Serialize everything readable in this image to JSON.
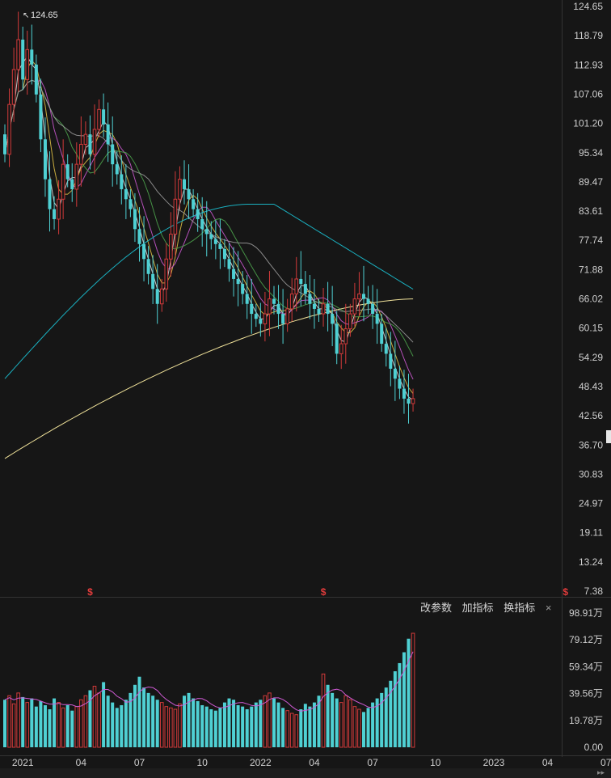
{
  "chart_data": {
    "type": "candlestick",
    "max_label": "124.65",
    "price_axis": [
      "124.65",
      "118.79",
      "112.93",
      "107.06",
      "101.20",
      "95.34",
      "89.47",
      "83.61",
      "77.74",
      "71.88",
      "66.02",
      "60.15",
      "54.29",
      "48.43",
      "42.56",
      "36.70",
      "30.83",
      "24.97",
      "19.11",
      "13.24",
      "7.38"
    ],
    "volume_axis": [
      "98.91万",
      "79.12万",
      "59.34万",
      "39.56万",
      "19.78万",
      "0.00"
    ],
    "x_labels": [
      {
        "label": "2021",
        "week": 4
      },
      {
        "label": "04",
        "week": 17
      },
      {
        "label": "07",
        "week": 30
      },
      {
        "label": "10",
        "week": 44
      },
      {
        "label": "2022",
        "week": 57
      },
      {
        "label": "04",
        "week": 69
      },
      {
        "label": "07",
        "week": 82
      },
      {
        "label": "10",
        "week": 96
      },
      {
        "label": "2023",
        "week": 109
      },
      {
        "label": "04",
        "week": 121
      },
      {
        "label": "07",
        "week": 134
      }
    ],
    "event_markers": [
      {
        "label": "$",
        "week": 19
      },
      {
        "label": "$",
        "week": 71
      },
      {
        "label": "$",
        "week": 125
      }
    ],
    "weekly_close": [
      95,
      105,
      112,
      118,
      110,
      116,
      113,
      107,
      98,
      90,
      84,
      82,
      86,
      93,
      90,
      88,
      93,
      97,
      99,
      95,
      100,
      104,
      101,
      97,
      93,
      91,
      88,
      86,
      84,
      80,
      77,
      74,
      71,
      68,
      65,
      68,
      74,
      79,
      86,
      90,
      88,
      86,
      84,
      82,
      80,
      79,
      78,
      77,
      76,
      74,
      72,
      70,
      69,
      67,
      65,
      63,
      62,
      61,
      63,
      66,
      65,
      63,
      61,
      64,
      67,
      70,
      69,
      67,
      65,
      64,
      63,
      65,
      63,
      61,
      55,
      57,
      60,
      63,
      66,
      67,
      66,
      65,
      63,
      61,
      57,
      55,
      52,
      50,
      48,
      46,
      45,
      46
    ],
    "volume_wan": [
      35,
      38,
      32,
      40,
      37,
      33,
      36,
      30,
      34,
      31,
      28,
      36,
      33,
      29,
      31,
      27,
      30,
      35,
      38,
      42,
      45,
      40,
      48,
      38,
      33,
      29,
      31,
      35,
      40,
      46,
      52,
      44,
      40,
      38,
      35,
      33,
      30,
      29,
      28,
      32,
      38,
      40,
      36,
      34,
      31,
      30,
      28,
      27,
      29,
      33,
      36,
      35,
      31,
      30,
      28,
      30,
      33,
      35,
      38,
      40,
      36,
      33,
      29,
      27,
      25,
      24,
      28,
      32,
      30,
      33,
      38,
      54,
      46,
      40,
      36,
      33,
      38,
      35,
      30,
      28,
      26,
      29,
      33,
      36,
      40,
      44,
      49,
      56,
      62,
      70,
      80,
      84
    ]
  },
  "toolbar": {
    "modify_params": "改参数",
    "add_indicator": "加指标",
    "switch_indicator": "换指标",
    "close_icon": "×"
  },
  "colors": {
    "up": "#d23a3a",
    "down": "#4fd0d3",
    "ma5": "#e6e6e6",
    "ma10": "#e8c646",
    "ma20": "#d05ad5",
    "ma30": "#4fa84f",
    "ma60": "#a0a0a0",
    "ma120": "#1ab0c0",
    "ma250": "#f0e29a",
    "marker": "#e33c3c"
  }
}
